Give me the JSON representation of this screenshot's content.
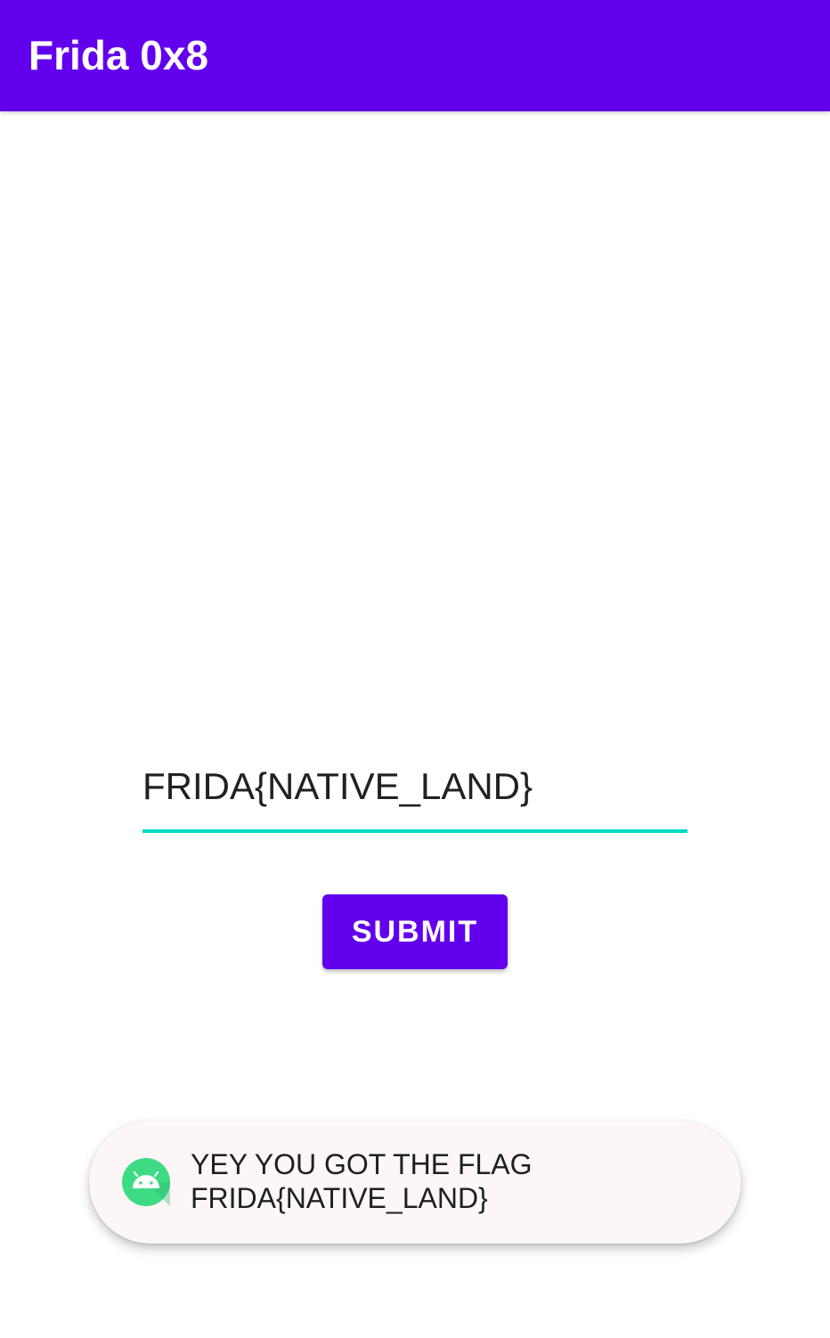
{
  "app_bar": {
    "title": "Frida 0x8",
    "background_color": "#6200ee"
  },
  "form": {
    "flag_input_value": "FRIDA{NATIVE_LAND}",
    "underline_color": "#03dac5",
    "submit_label": "SUBMIT"
  },
  "toast": {
    "icon": "android-icon",
    "line1": "YEY YOU GOT THE FLAG",
    "line2": "FRIDA{NATIVE_LAND}"
  }
}
